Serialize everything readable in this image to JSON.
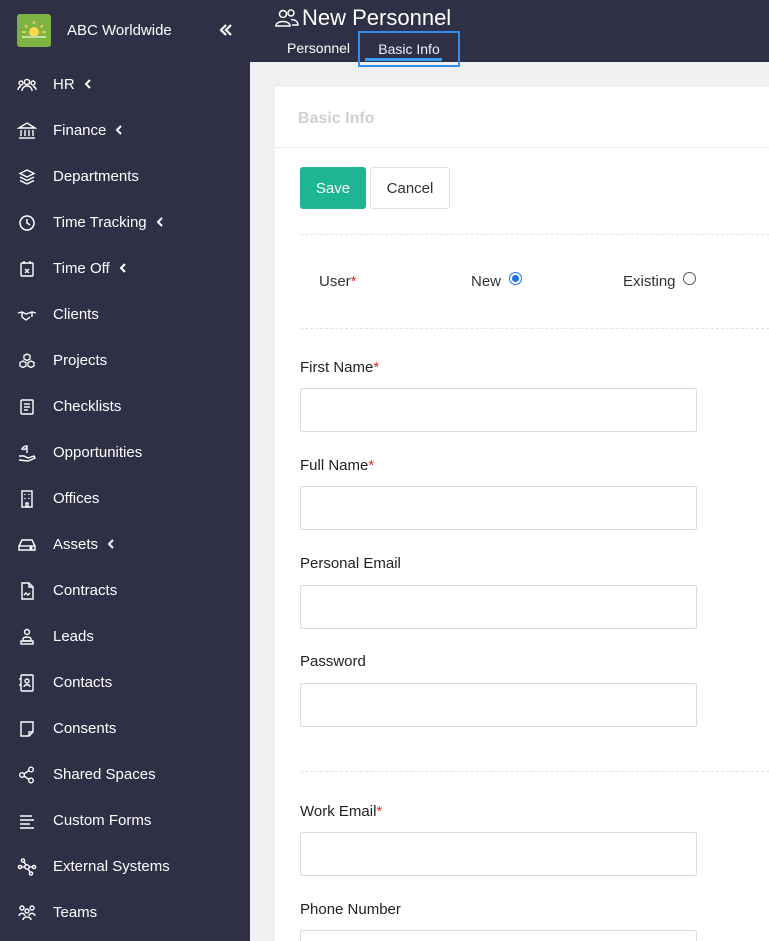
{
  "brand": {
    "name": "ABC Worldwide",
    "logo_color": "#7cb342"
  },
  "sidebar": {
    "background": "#2f3045",
    "items": [
      {
        "label": "HR",
        "icon": "people-group-icon",
        "has_submenu": true
      },
      {
        "label": "Finance",
        "icon": "bank-icon",
        "has_submenu": true
      },
      {
        "label": "Departments",
        "icon": "layers-icon",
        "has_submenu": false
      },
      {
        "label": "Time Tracking",
        "icon": "clock-icon",
        "has_submenu": true
      },
      {
        "label": "Time Off",
        "icon": "calendar-x-icon",
        "has_submenu": true
      },
      {
        "label": "Clients",
        "icon": "handshake-icon",
        "has_submenu": false
      },
      {
        "label": "Projects",
        "icon": "cubes-icon",
        "has_submenu": false
      },
      {
        "label": "Checklists",
        "icon": "checklist-icon",
        "has_submenu": false
      },
      {
        "label": "Opportunities",
        "icon": "hand-seedling-icon",
        "has_submenu": false
      },
      {
        "label": "Offices",
        "icon": "building-icon",
        "has_submenu": false
      },
      {
        "label": "Assets",
        "icon": "hard-drive-icon",
        "has_submenu": true
      },
      {
        "label": "Contracts",
        "icon": "contract-document-icon",
        "has_submenu": false
      },
      {
        "label": "Leads",
        "icon": "person-stand-icon",
        "has_submenu": false
      },
      {
        "label": "Contacts",
        "icon": "contact-book-icon",
        "has_submenu": false
      },
      {
        "label": "Consents",
        "icon": "note-icon",
        "has_submenu": false
      },
      {
        "label": "Shared Spaces",
        "icon": "share-nodes-icon",
        "has_submenu": false
      },
      {
        "label": "Custom Forms",
        "icon": "form-lines-icon",
        "has_submenu": false
      },
      {
        "label": "External Systems",
        "icon": "network-icon",
        "has_submenu": false
      },
      {
        "label": "Teams",
        "icon": "team-icon",
        "has_submenu": false
      }
    ]
  },
  "header": {
    "title": "New Personnel",
    "title_icon": "users-icon",
    "tabs": [
      {
        "label": "Personnel",
        "active": false
      },
      {
        "label": "Basic Info",
        "active": true
      }
    ]
  },
  "form": {
    "section_title": "Basic Info",
    "save_label": "Save",
    "cancel_label": "Cancel",
    "user_label": "User",
    "required_mark": "*",
    "user_options": [
      {
        "label": "New",
        "selected": true
      },
      {
        "label": "Existing",
        "selected": false
      }
    ],
    "fields": {
      "first_name": {
        "label": "First Name",
        "required": true,
        "value": ""
      },
      "full_name": {
        "label": "Full Name",
        "required": true,
        "value": ""
      },
      "personal_email": {
        "label": "Personal Email",
        "required": false,
        "value": ""
      },
      "password": {
        "label": "Password",
        "required": false,
        "value": ""
      },
      "work_email": {
        "label": "Work Email",
        "required": true,
        "value": ""
      },
      "phone_number": {
        "label": "Phone Number",
        "required": false,
        "value": ""
      }
    }
  },
  "colors": {
    "accent": "#1eb594",
    "active_tab_border": "#2e8ff0",
    "required": "#d32f2f"
  }
}
